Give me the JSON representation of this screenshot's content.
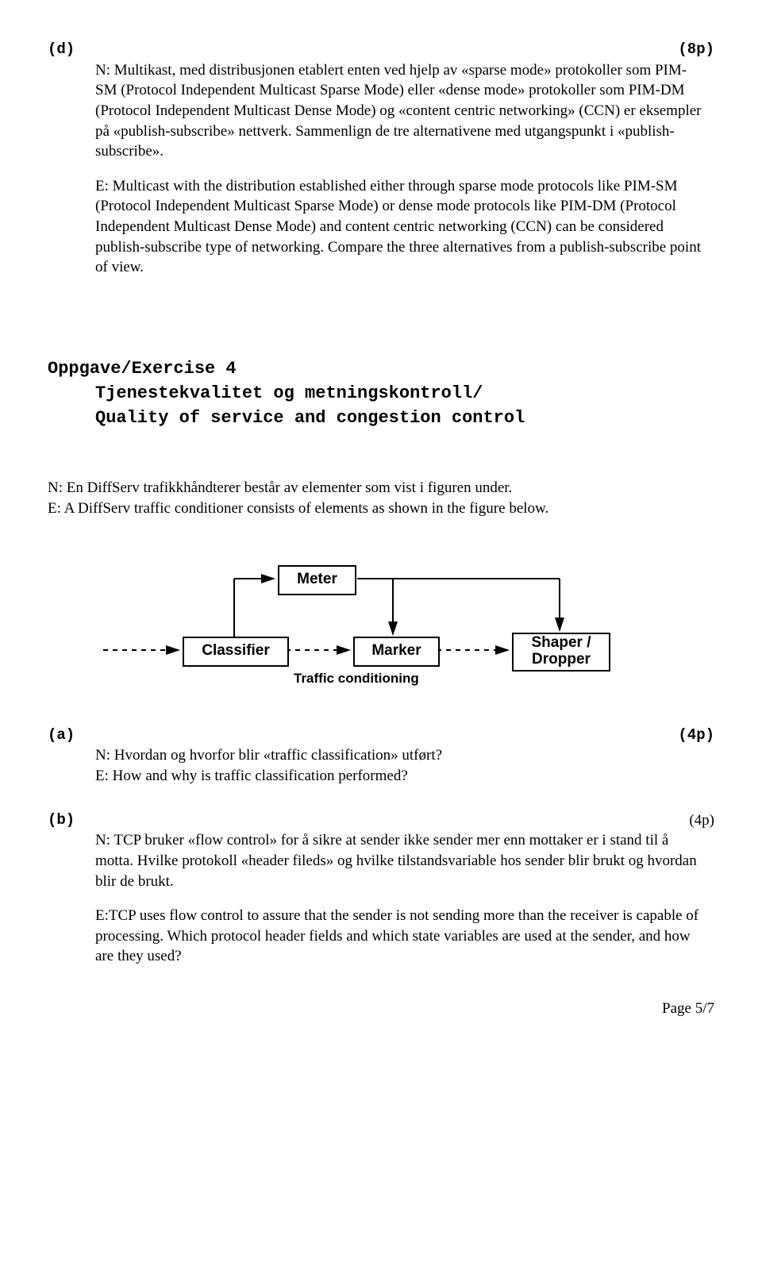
{
  "d": {
    "label": "(d)",
    "points": "(8p)",
    "n": "N: Multikast, med distribusjonen etablert enten ved hjelp av «sparse mode» protokoller som PIM-SM (Protocol Independent Multicast Sparse Mode) eller «dense mode» protokoller som PIM-DM (Protocol Independent Multicast Dense Mode) og «content centric networking» (CCN) er eksempler på «publish-subscribe»  nettverk. Sammenlign de tre alternativene med utgangspunkt i «publish-subscribe».",
    "e": "E: Multicast with the distribution established either through sparse mode protocols like PIM-SM (Protocol Independent Multicast Sparse Mode) or dense mode protocols like PIM-DM (Protocol Independent Multicast Dense Mode) and content centric networking (CCN) can be considered publish-subscribe type of networking. Compare the three alternatives from a publish-subscribe point of view."
  },
  "exercise": {
    "title": "Oppgave/Exercise 4",
    "sub1": "Tjenestekvalitet og metningskontroll/",
    "sub2": "Quality of service and congestion control"
  },
  "intro": {
    "n": "N: En DiffServ trafikkhåndterer består av elementer som vist i figuren under.",
    "e": "E: A DiffServ traffic conditioner consists of elements as shown in the figure below."
  },
  "diagram": {
    "meter": "Meter",
    "classifier": "Classifier",
    "marker": "Marker",
    "shaper": "Shaper / Dropper",
    "caption": "Traffic conditioning"
  },
  "a": {
    "label": "(a)",
    "points": "(4p)",
    "n": "N: Hvordan og hvorfor blir «traffic classification» utført?",
    "e": "E: How and why is traffic classification performed?"
  },
  "b": {
    "label": "(b)",
    "points": "(4p)",
    "n": "N: TCP bruker «flow control» for å sikre at sender ikke sender mer enn mottaker er i stand til å motta. Hvilke protokoll «header fileds» og hvilke tilstandsvariable hos sender blir brukt og hvordan blir de brukt.",
    "e": "E:TCP uses flow control to assure that the sender is not sending more than the receiver is capable of processing. Which protocol header fields and which state variables are used at the sender, and how are they used?"
  },
  "footer": "Page 5/7"
}
